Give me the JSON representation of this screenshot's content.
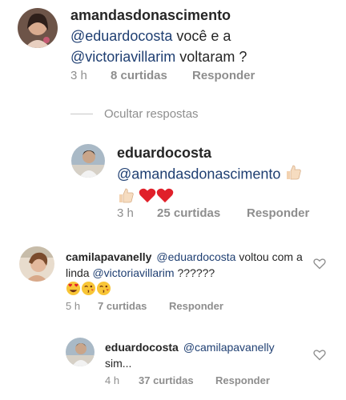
{
  "comments": [
    {
      "username": "amandasdonascimento",
      "parts": [
        {
          "type": "mention",
          "text": "@eduardocosta"
        },
        {
          "type": "text",
          "text": " você e a "
        },
        {
          "type": "mention",
          "text": "@victoriavillarim"
        },
        {
          "type": "text",
          "text": " voltaram ?"
        }
      ],
      "time": "3 h",
      "likes": "8 curtidas",
      "reply": "Responder"
    },
    {
      "username": "eduardocosta",
      "parts": [
        {
          "type": "mention",
          "text": "@amandasdonascimento"
        }
      ],
      "emojis": [
        "thumbs-up",
        "thumbs-up",
        "heart",
        "heart"
      ],
      "time": "3 h",
      "likes": "25 curtidas",
      "reply": "Responder"
    },
    {
      "username": "camilapavanelly",
      "parts": [
        {
          "type": "mention",
          "text": "@eduardocosta"
        },
        {
          "type": "text",
          "text": "  voltou com a linda "
        },
        {
          "type": "mention",
          "text": "@victoriavillarim"
        },
        {
          "type": "text",
          "text": " ??????"
        }
      ],
      "emojis": [
        "heart-eyes",
        "kiss-wink",
        "kiss-wink"
      ],
      "time": "5 h",
      "likes": "7 curtidas",
      "reply": "Responder"
    },
    {
      "username": "eduardocosta",
      "parts": [
        {
          "type": "mention",
          "text": "@camilapavanelly"
        },
        {
          "type": "text",
          "text": " sim..."
        }
      ],
      "time": "4 h",
      "likes": "37 curtidas",
      "reply": "Responder"
    }
  ],
  "hide_replies_label": "Ocultar respostas",
  "colors": {
    "mention": "#1f3f72",
    "meta": "#8e8e8e",
    "heart_red": "#e0202a"
  }
}
